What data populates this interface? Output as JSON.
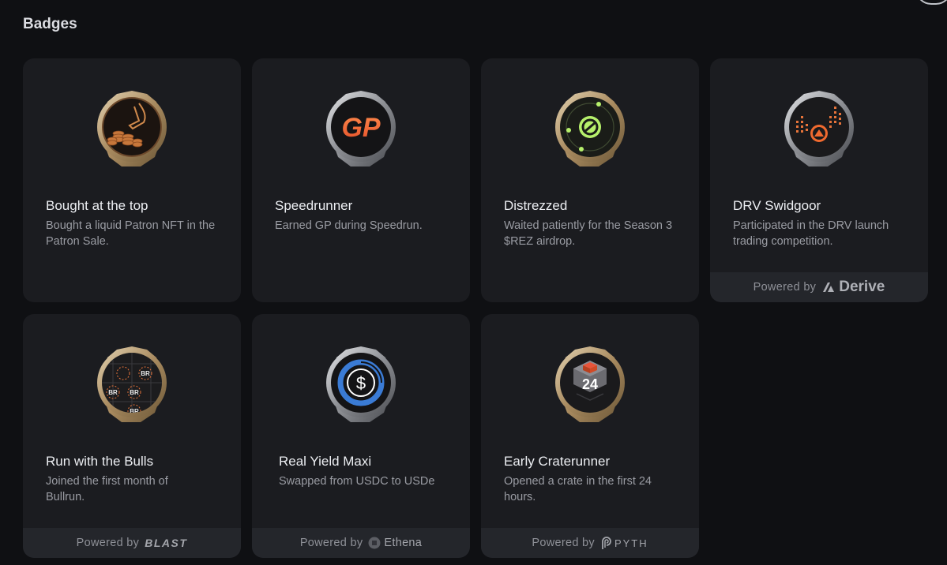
{
  "header": {
    "title": "Badges"
  },
  "badges": [
    {
      "title": "Bought at the top",
      "description": "Bought a liquid Patron NFT in the Patron Sale.",
      "icon": "coins-hand-icon",
      "footer": null
    },
    {
      "title": "Speedrunner",
      "description": "Earned GP during Speedrun.",
      "icon": "gp-icon",
      "badge_text": "GP",
      "footer": null
    },
    {
      "title": "Distrezzed",
      "description": "Waited patiently for the Season 3 $REZ airdrop.",
      "icon": "orbit-icon",
      "footer": null
    },
    {
      "title": "DRV Swidgoor",
      "description": "Participated in the DRV launch trading competition.",
      "icon": "equalizer-icon",
      "footer": {
        "prefix": "Powered by",
        "brand": "Derive"
      }
    },
    {
      "title": "Run with the Bulls",
      "description": "Joined the first month of Bullrun.",
      "icon": "bull-grid-icon",
      "badge_text": "BR",
      "footer": {
        "prefix": "Powered by",
        "brand": "BLAST"
      }
    },
    {
      "title": "Real Yield Maxi",
      "description": "Swapped from USDC to USDe",
      "icon": "dollar-icon",
      "badge_text": "$",
      "footer": {
        "prefix": "Powered by",
        "brand": "Ethena"
      }
    },
    {
      "title": "Early Craterunner",
      "description": "Opened a crate in the first 24 hours.",
      "icon": "crate-icon",
      "badge_text": "24",
      "footer": {
        "prefix": "Powered by",
        "brand": "PYTH"
      }
    }
  ],
  "colors": {
    "background": "#0f1013",
    "card": "#1b1c20",
    "footer": "#24262b",
    "gold_rim": "#b9a27f",
    "silver_rim": "#a7a9ad",
    "accent_orange": "#f06a2f",
    "accent_green": "#b6f06b",
    "accent_blue": "#3a7bd5"
  }
}
